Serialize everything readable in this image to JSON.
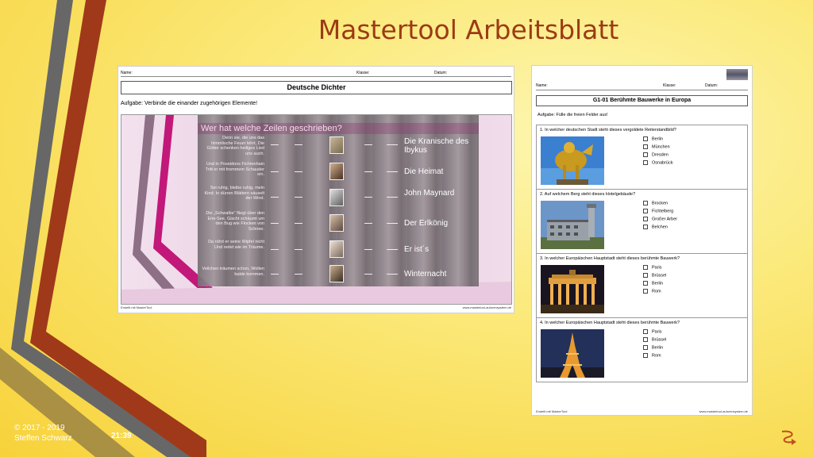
{
  "slide": {
    "title": "Mastertool  Arbeitsblatt",
    "footer_copyright": "© 2017 - 2019",
    "footer_author": "Steffen Schwarz",
    "footer_time": "21:39",
    "colors": {
      "title": "#9c3a14",
      "stripe_gray": "#676767",
      "stripe_rust": "#a0391a",
      "background": "#f7d23a"
    }
  },
  "worksheet1": {
    "name_label": "Name:",
    "class_label": "Klasse:",
    "date_label": "Datum:",
    "title": "Deutsche Dichter",
    "task": "Aufgabe: Verbinde die einander zugehörigen Elemente!",
    "exercise_heading": "Wer hat welche Zeilen geschrieben?",
    "quotes": [
      "Denn sie, die uns das himmlische Feuer lehrt, Die Götter schenken heiliges Lied uns auch.",
      "Und in Poseidons Fichtenhain Tritt er mit frommem Schauder ein.",
      "Sei ruhig, bleibe ruhig, mein Kind; In dürren Blättern säuselt der Wind.",
      "Die „Schwalbe“ fliegt über den Erie-See, Gischt schäumt um den Bug wie Flocken von Schnee.",
      "Da rührt er seine Wipfel nicht Und redet wie im Träume.",
      "Veilchen träumen schon, Wollen balde kommen."
    ],
    "poems": [
      "Die Kranische des Ibykus",
      "Die Heimat",
      "John Maynard",
      "Der Erlkönig",
      "Er ist´s",
      "Winternacht"
    ],
    "footer_left": "Erstellt mit MasterTool",
    "footer_right": "www.mastertool-autorensystem.de"
  },
  "worksheet2": {
    "name_label": "Name:",
    "class_label": "Klasse:",
    "date_label": "Datum:",
    "title": "G1-01 Berühmte Bauwerke in Europa",
    "task": "Aufgabe: Fülle die freien Felder aus!",
    "questions": [
      {
        "text": "1. In welcher deutschen Stadt steht dieses vergoldete Reiterstandbild?",
        "options": [
          "Berlin",
          "München",
          "Dresden",
          "Osnabrück"
        ]
      },
      {
        "text": "2. Auf welchem Berg steht dieses Hotelgebäude?",
        "options": [
          "Brocken",
          "Fichtelberg",
          "Großer Arber",
          "Belchen"
        ]
      },
      {
        "text": "3. In welcher Europäischen Hauptstadt steht dieses berühmte Bauwerk?",
        "options": [
          "Paris",
          "Brüssel",
          "Berlin",
          "Rom"
        ]
      },
      {
        "text": "4. In welcher Europäischen Hauptstadt steht dieses berühmte Bauwerk?",
        "options": [
          "Paris",
          "Brüssel",
          "Berlin",
          "Rom"
        ]
      }
    ],
    "footer_left": "Erstellt mit MasterTool",
    "footer_right": "www.mastertool-autorensystem.de"
  },
  "icons": {
    "next": "next-slide-arrow-icon"
  }
}
